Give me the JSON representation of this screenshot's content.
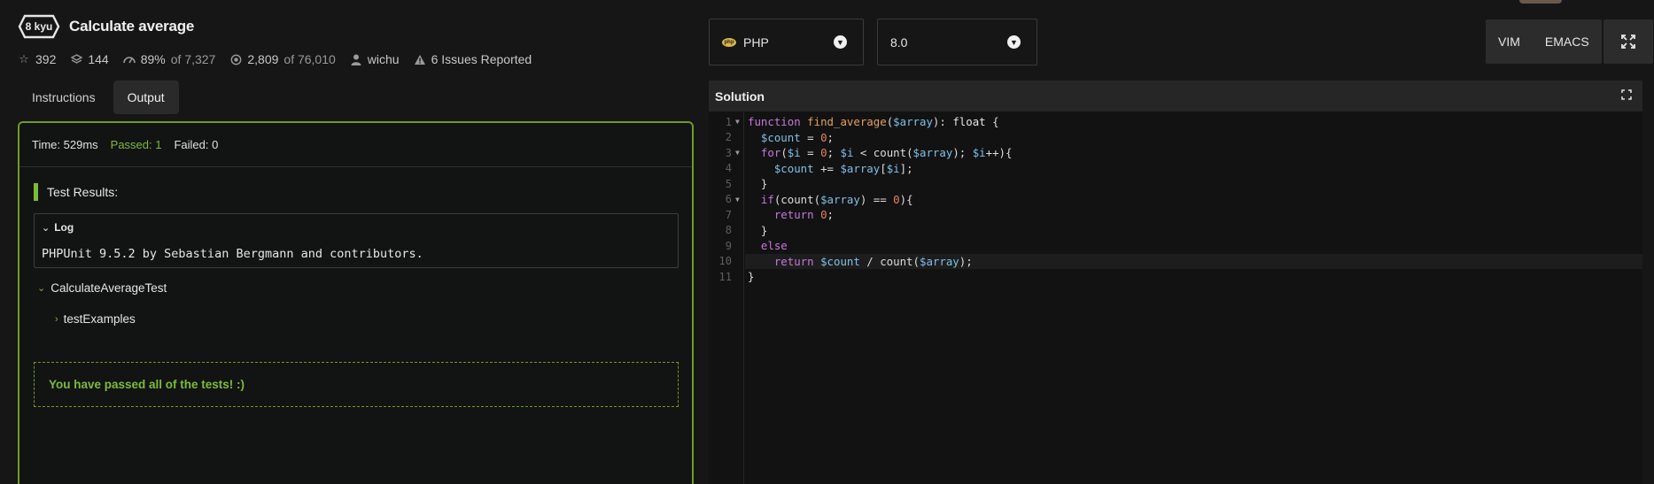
{
  "kata": {
    "rank": "8 kyu",
    "title": "Calculate average",
    "stats": {
      "stars": "392",
      "collections": "144",
      "satisfaction": "89%",
      "satisfaction_of": "of 7,327",
      "completed": "2,809",
      "completed_of": "of 76,010",
      "author": "wichu",
      "issues": "6 Issues Reported"
    }
  },
  "tabs": {
    "instructions": "Instructions",
    "output": "Output"
  },
  "output": {
    "time": "Time: 529ms",
    "passed": "Passed: 1",
    "failed": "Failed: 0",
    "results_title": "Test Results:",
    "log_label": "Log",
    "log_text": "PHPUnit 9.5.2 by Sebastian Bergmann and contributors.",
    "test_suite": "CalculateAverageTest",
    "test_case": "testExamples",
    "pass_message": "You have passed all of the tests! :)"
  },
  "language": {
    "selected": "PHP",
    "version": "8.0"
  },
  "editor_modes": {
    "vim": "VIM",
    "emacs": "EMACS"
  },
  "solution": {
    "title": "Solution",
    "line_numbers": [
      "1",
      "2",
      "3",
      "4",
      "5",
      "6",
      "7",
      "8",
      "9",
      "10",
      "11"
    ]
  },
  "colors": {
    "accent_green": "#7dbb3a",
    "border_green": "#6f9a29",
    "background": "#161616"
  }
}
